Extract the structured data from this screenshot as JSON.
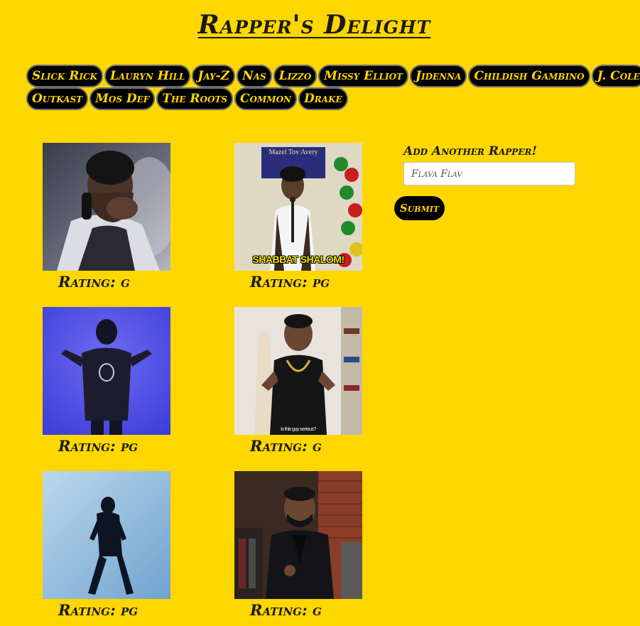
{
  "page": {
    "title": "Rapper's Delight"
  },
  "rappers": [
    [
      "Slick Rick",
      "Lauryn Hill",
      "Jay-Z",
      "Nas",
      "Lizzo",
      "Missy Elliot",
      "Jidenna",
      "Childish Gambino",
      "J. Cole"
    ],
    [
      "Outkast",
      "Mos Def",
      "The Roots",
      "Common",
      "Drake"
    ]
  ],
  "gifs": [
    {
      "rating": "Rating: g",
      "caption": ""
    },
    {
      "rating": "Rating: pg",
      "caption": "SHABBAT SHALOM!",
      "banner": "Mazel Tov Avery"
    },
    {
      "rating": "Rating: pg",
      "caption": ""
    },
    {
      "rating": "Rating: g",
      "caption": "is this guy serious?"
    },
    {
      "rating": "Rating: pg",
      "caption": ""
    },
    {
      "rating": "Rating: g",
      "caption": ""
    }
  ],
  "form": {
    "label": "Add Another Rapper!",
    "placeholder": "Flava Flav",
    "submit_label": "Submit"
  },
  "colors": {
    "background": "#FFD700",
    "button_bg": "#000000",
    "button_text": "#FFD700"
  }
}
